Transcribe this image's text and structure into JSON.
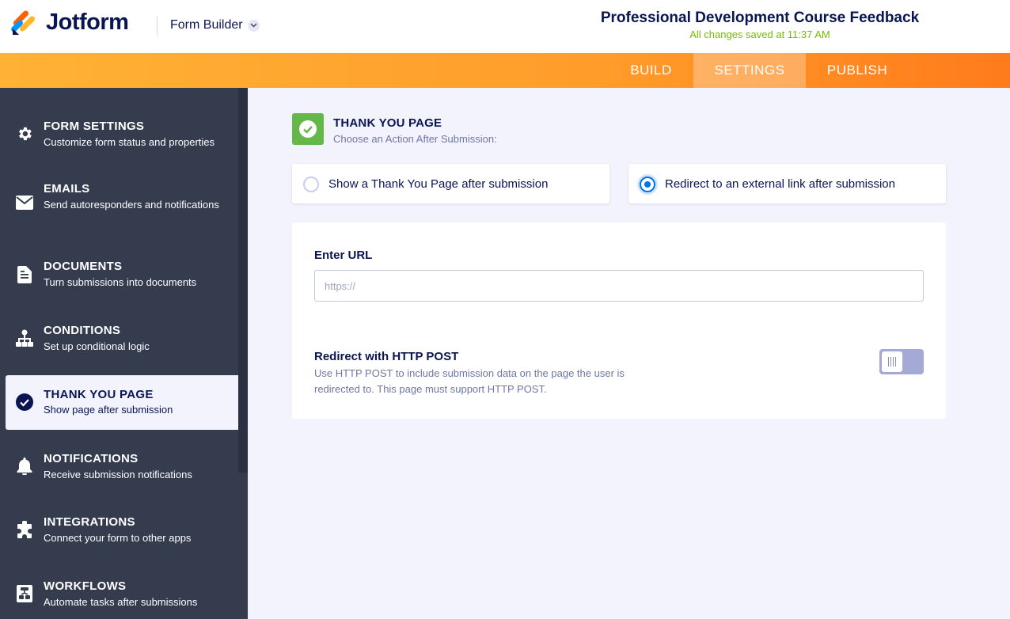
{
  "header": {
    "brand": "Jotform",
    "builder_label": "Form Builder",
    "form_title": "Professional Development Course Feedback",
    "saved_status": "All changes saved at 11:37 AM"
  },
  "navbar": {
    "tabs": [
      {
        "label": "BUILD"
      },
      {
        "label": "SETTINGS",
        "active": true
      },
      {
        "label": "PUBLISH"
      }
    ]
  },
  "sidebar": {
    "items": [
      {
        "title": "FORM SETTINGS",
        "desc": "Customize form status and properties",
        "icon": "gear-icon"
      },
      {
        "title": "EMAILS",
        "desc": "Send autoresponders and notifications",
        "icon": "envelope-icon"
      },
      {
        "title": "DOCUMENTS",
        "desc": "Turn submissions into documents",
        "icon": "document-icon"
      },
      {
        "title": "CONDITIONS",
        "desc": "Set up conditional logic",
        "icon": "sitemap-icon"
      },
      {
        "title": "THANK YOU PAGE",
        "desc": "Show page after submission",
        "icon": "check-circle-icon",
        "active": true
      },
      {
        "title": "NOTIFICATIONS",
        "desc": "Receive submission notifications",
        "icon": "bell-icon"
      },
      {
        "title": "INTEGRATIONS",
        "desc": "Connect your form to other apps",
        "icon": "puzzle-icon"
      },
      {
        "title": "WORKFLOWS",
        "desc": "Automate tasks after submissions",
        "icon": "workflow-icon"
      }
    ]
  },
  "main": {
    "section_title": "THANK YOU PAGE",
    "section_subtitle": "Choose an Action After Submission:",
    "options": [
      {
        "label": "Show a Thank You Page after submission",
        "selected": false
      },
      {
        "label": "Redirect to an external link after submission",
        "selected": true
      }
    ],
    "url": {
      "label": "Enter URL",
      "value": "",
      "placeholder": "https://"
    },
    "http_post": {
      "title": "Redirect with HTTP POST",
      "desc": "Use HTTP POST to include submission data on the page the user is redirected to. This page must support HTTP POST.",
      "enabled": false
    }
  },
  "colors": {
    "accent_orange": "#ff9c2a",
    "sidebar_bg": "#343c4e",
    "success_green": "#64b749",
    "radio_blue": "#0075e3",
    "saved_green": "#78bb07"
  }
}
